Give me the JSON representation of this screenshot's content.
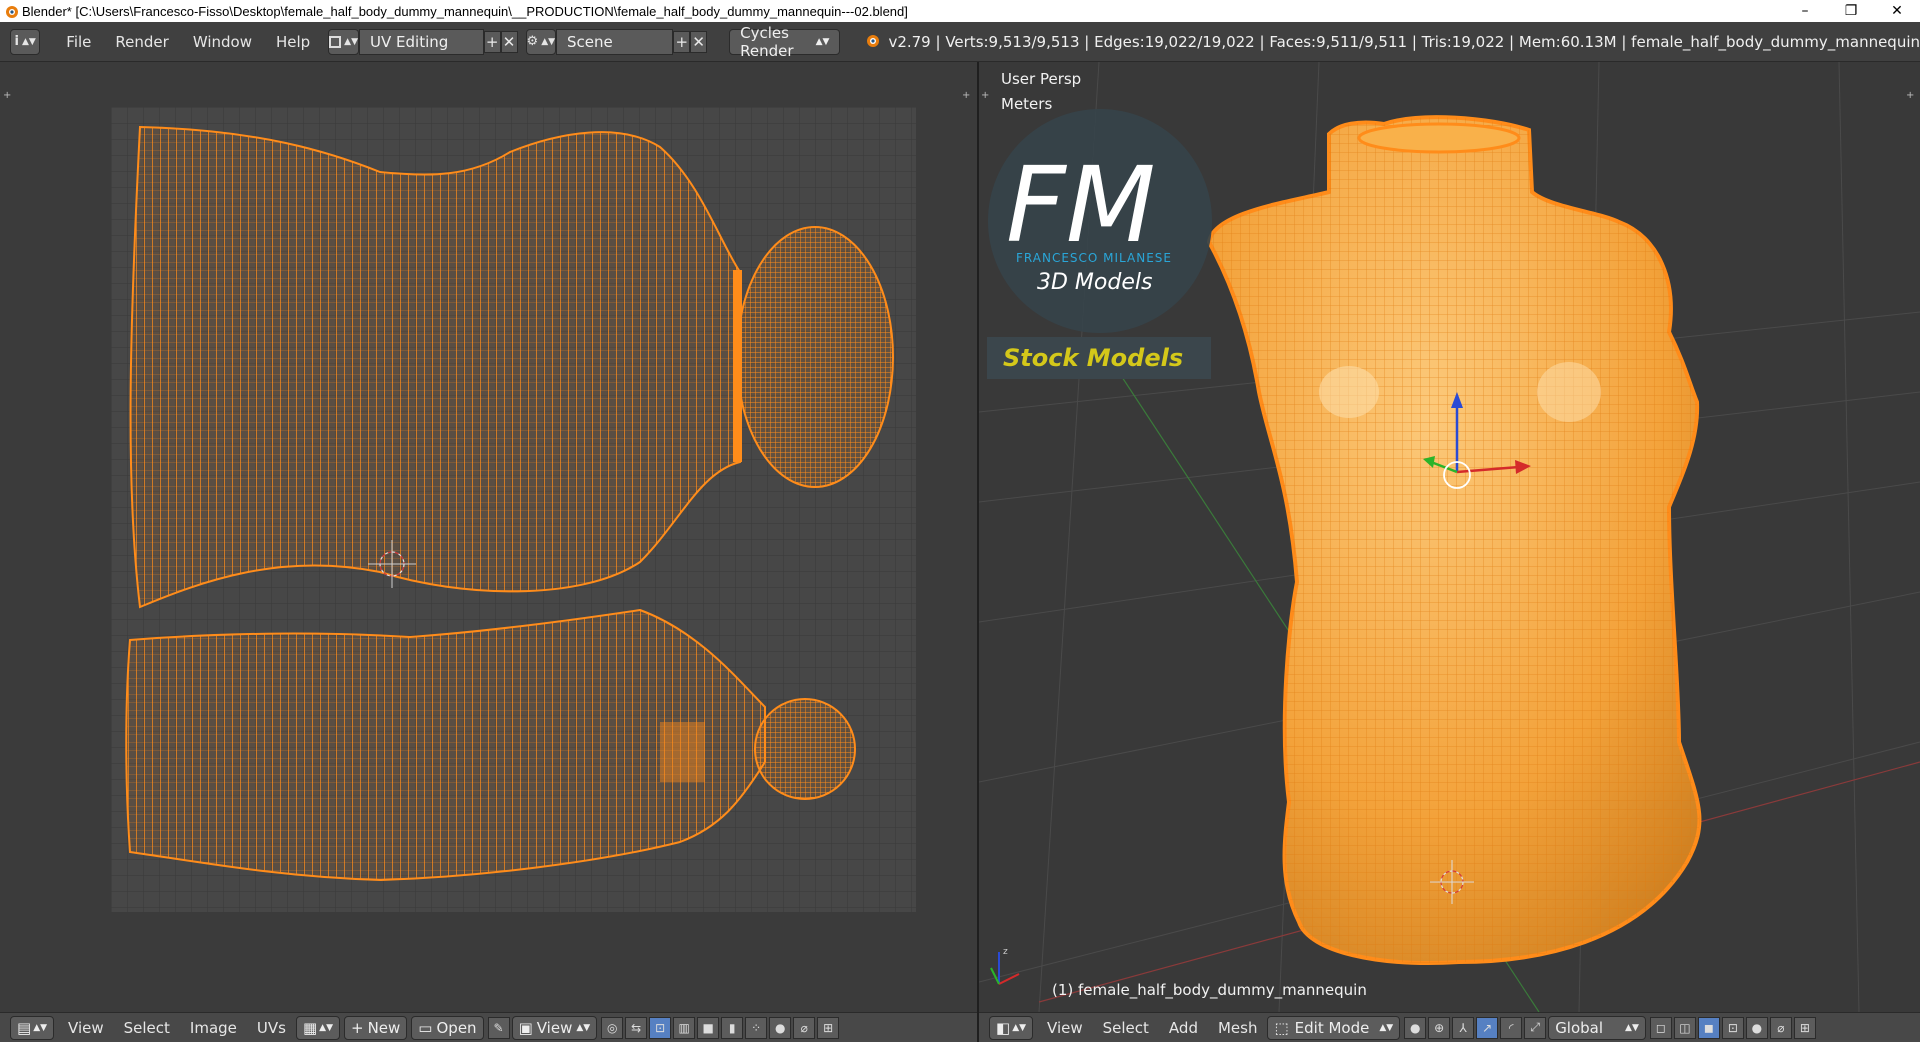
{
  "window": {
    "title": "Blender* [C:\\Users\\Francesco-Fisso\\Desktop\\female_half_body_dummy_mannequin\\__PRODUCTION\\female_half_body_dummy_mannequin---02.blend]",
    "minimize": "–",
    "restore": "❐",
    "close": "✕"
  },
  "header": {
    "info_icon": "i",
    "menus": [
      "File",
      "Render",
      "Window",
      "Help"
    ],
    "screen_layout": "UV Editing",
    "scene": "Scene",
    "add_symbol": "+",
    "remove_symbol": "✕",
    "render_engine": "Cycles Render",
    "stats": "v2.79 | Verts:9,513/9,513 | Edges:19,022/19,022 | Faces:9,511/9,511 | Tris:19,022 | Mem:60.13M | female_half_body_dummy_mannequin"
  },
  "uv_editor": {
    "menus": [
      "View",
      "Select",
      "Image",
      "UVs"
    ],
    "new_label": "New",
    "open_label": "Open",
    "view_label": "View"
  },
  "viewport": {
    "view_name": "User Persp",
    "units": "Meters",
    "object_label": "(1) female_half_body_dummy_mannequin",
    "menus": [
      "View",
      "Select",
      "Add",
      "Mesh"
    ],
    "mode": "Edit Mode",
    "orientation": "Global"
  },
  "watermark": {
    "logo_letters": "FM",
    "author": "FRANCESCO MILANESE",
    "subtitle": "3D Models",
    "banner": "Stock Models"
  },
  "colors": {
    "mesh_orange": "#ff8c1a",
    "mesh_fill": "#f7a73a",
    "grid_bg": "#444444",
    "logo_blue": "#2aa6d8",
    "banner_yellow": "#d4c81a",
    "axis_red": "#d42a2a",
    "axis_green": "#2ab42a",
    "axis_blue": "#2a4ad4"
  }
}
